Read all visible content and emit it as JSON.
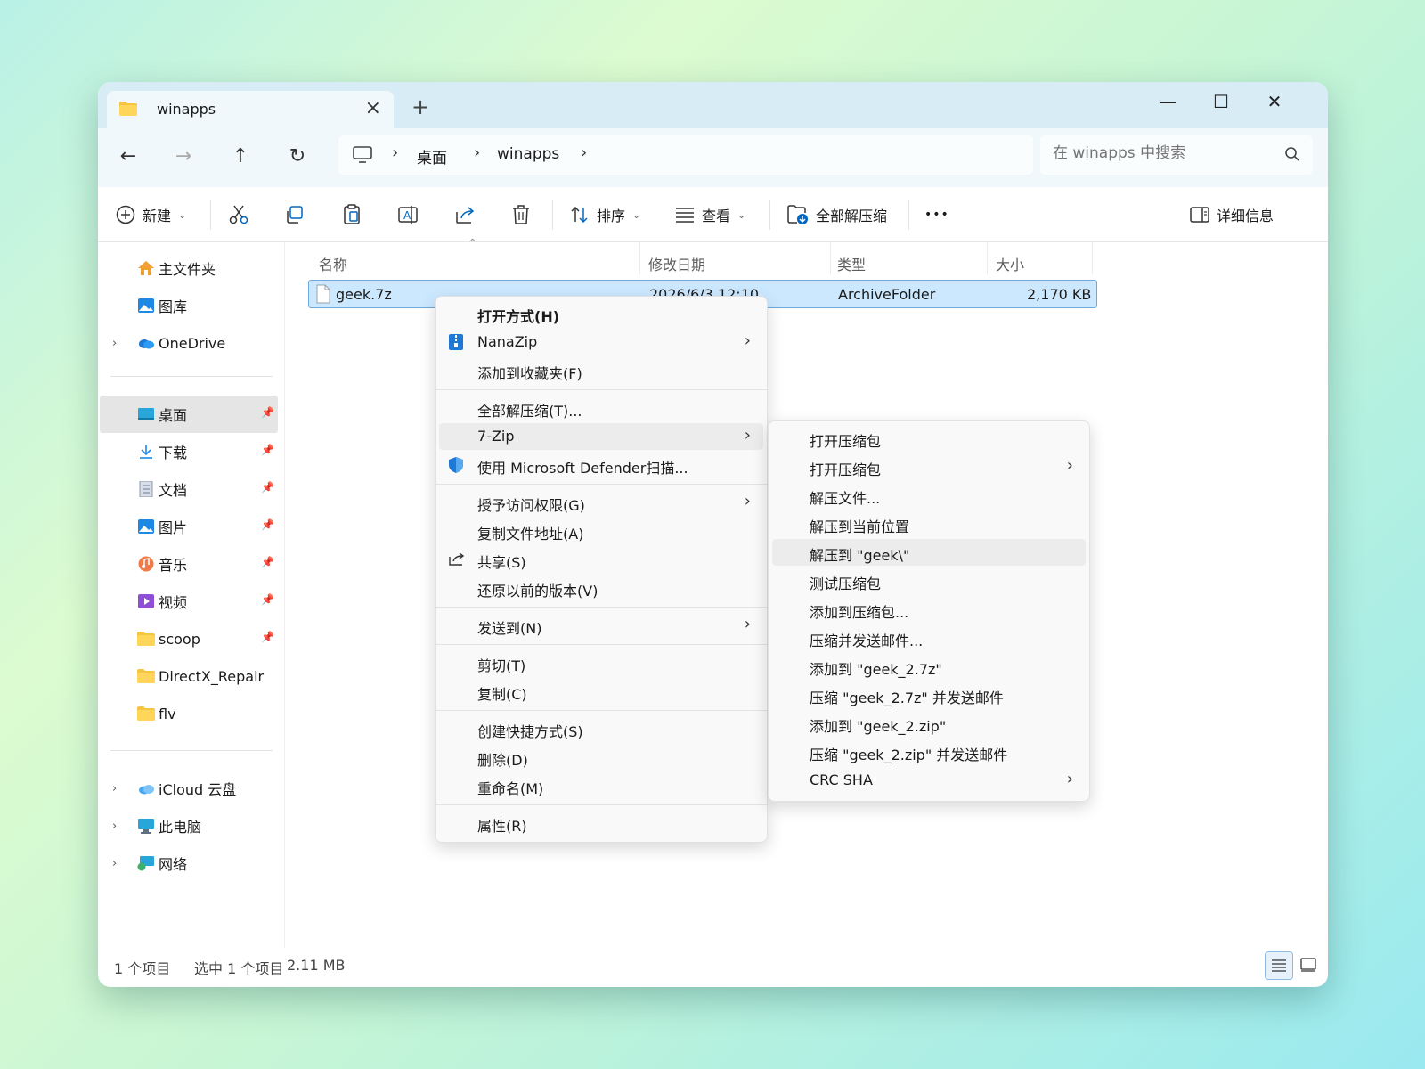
{
  "tab": {
    "title": "winapps",
    "close": "×",
    "new": "+"
  },
  "window_controls": {
    "minimize": "—",
    "maximize": "☐",
    "close": "✕"
  },
  "nav": {
    "back": "←",
    "forward": "→",
    "up": "↑",
    "refresh": "↻"
  },
  "breadcrumb": {
    "items": [
      "桌面",
      "winapps"
    ],
    "sep": "›"
  },
  "search": {
    "placeholder": "在 winapps 中搜索"
  },
  "toolbar": {
    "new_label": "新建",
    "sort_label": "排序",
    "view_label": "查看",
    "extract_all_label": "全部解压缩",
    "more_label": "•••",
    "details_label": "详细信息"
  },
  "sidebar": {
    "home": "主文件夹",
    "gallery": "图库",
    "onedrive": "OneDrive",
    "desktop": "桌面",
    "downloads": "下载",
    "documents": "文档",
    "pictures": "图片",
    "music": "音乐",
    "videos": "视频",
    "scoop": "scoop",
    "directx": "DirectX_Repair",
    "flv": "flv",
    "icloud": "iCloud 云盘",
    "thispc": "此电脑",
    "network": "网络"
  },
  "columns": {
    "name": "名称",
    "date": "修改日期",
    "type": "类型",
    "size": "大小"
  },
  "file": {
    "name": "geek.7z",
    "date": "2026/6/3 12:10",
    "type": "ArchiveFolder",
    "size": "2,170 KB"
  },
  "status": {
    "count": "1 个项目",
    "selected": "选中 1 个项目",
    "size": "2.11 MB"
  },
  "context_menu": {
    "open_with": "打开方式(H)",
    "nanazip": "NanaZip",
    "add_favorites": "添加到收藏夹(F)",
    "extract_all": "全部解压缩(T)...",
    "sevenzip": "7-Zip",
    "defender": "使用 Microsoft Defender扫描...",
    "grant_access": "授予访问权限(G)",
    "copy_path": "复制文件地址(A)",
    "share": "共享(S)",
    "restore": "还原以前的版本(V)",
    "send_to": "发送到(N)",
    "cut": "剪切(T)",
    "copy": "复制(C)",
    "shortcut": "创建快捷方式(S)",
    "delete": "删除(D)",
    "rename": "重命名(M)",
    "properties": "属性(R)"
  },
  "submenu_7zip": {
    "open_archive": "打开压缩包",
    "open_archive_sub": "打开压缩包",
    "extract_files": "解压文件...",
    "extract_here": "解压到当前位置",
    "extract_to": "解压到 \"geek\\\"",
    "test": "测试压缩包",
    "add_to_archive": "添加到压缩包...",
    "compress_email": "压缩并发送邮件...",
    "add_7z": "添加到 \"geek_2.7z\"",
    "compress_7z_email": "压缩 \"geek_2.7z\" 并发送邮件",
    "add_zip": "添加到 \"geek_2.zip\"",
    "compress_zip_email": "压缩 \"geek_2.zip\" 并发送邮件",
    "crc": "CRC SHA"
  },
  "colors": {
    "accent": "#0067c0",
    "selection": "#cce8ff",
    "titlebar": "#d7ecf4"
  }
}
